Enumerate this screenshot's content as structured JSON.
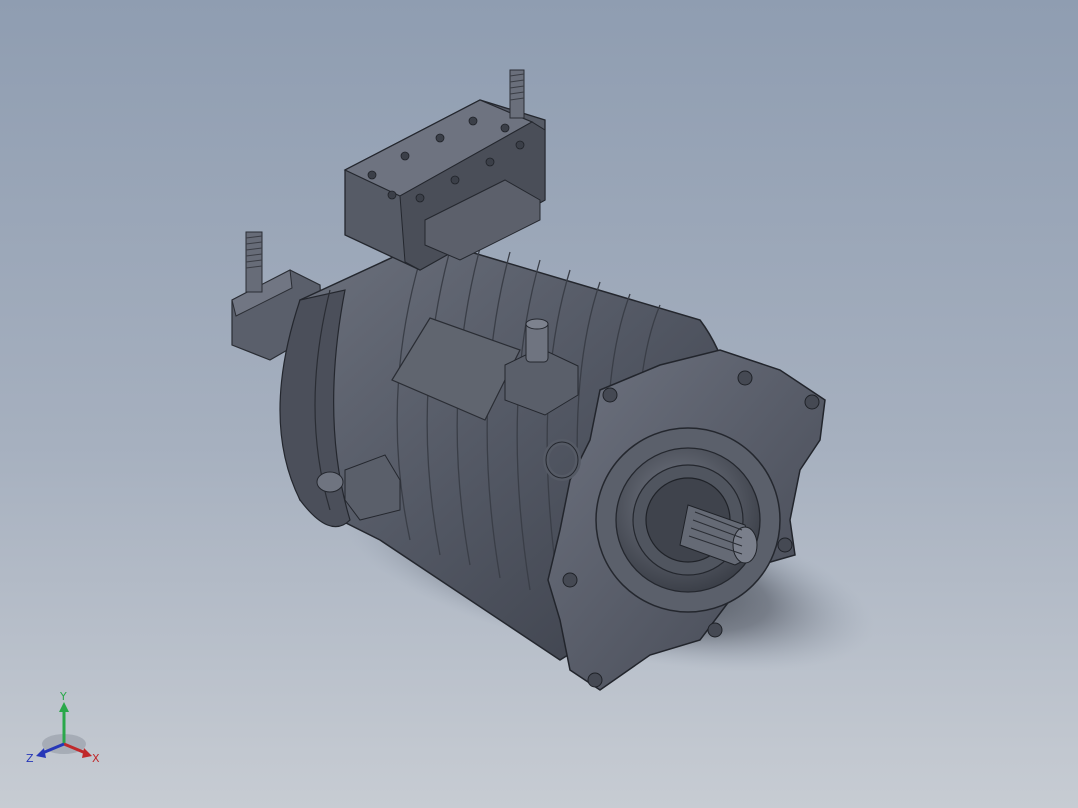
{
  "viewport": {
    "background_top": "#8f9db1",
    "background_bottom": "#c7ccd3",
    "model_color": "#555a66",
    "model_highlight": "#7b808c",
    "model_dark": "#2f323a"
  },
  "model": {
    "icon": "electric-motor-3d-model"
  },
  "triad": {
    "y_label": "Y",
    "x_label": "X",
    "z_label": "Z",
    "y_color": "#2aa84a",
    "x_color": "#c0282a",
    "z_color": "#2637b8"
  }
}
